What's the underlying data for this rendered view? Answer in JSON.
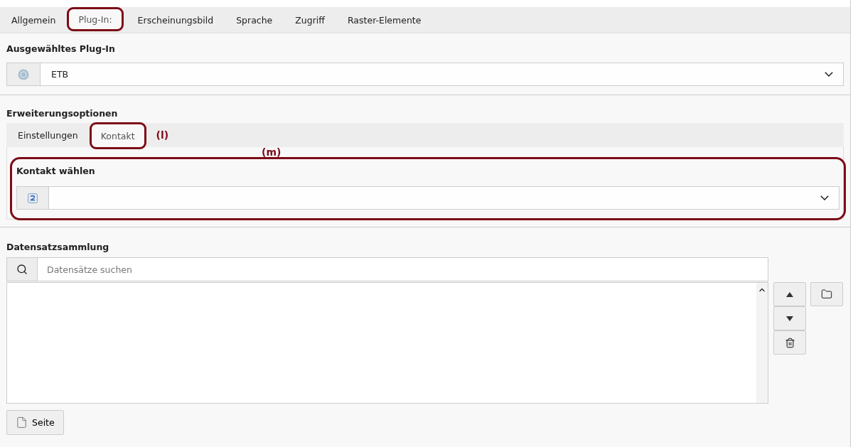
{
  "tabs": [
    {
      "label": "Allgemein",
      "selected": false,
      "highlighted": false
    },
    {
      "label": "Plug-In:",
      "selected": true,
      "highlighted": true
    },
    {
      "label": "Erscheinungsbild",
      "selected": false,
      "highlighted": false
    },
    {
      "label": "Sprache",
      "selected": false,
      "highlighted": false
    },
    {
      "label": "Zugriff",
      "selected": false,
      "highlighted": false
    },
    {
      "label": "Raster-Elemente",
      "selected": false,
      "highlighted": false
    }
  ],
  "plugin": {
    "label": "Ausgewähltes Plug-In",
    "value": "ETB"
  },
  "extension": {
    "label": "Erweiterungsoptionen",
    "tabs": [
      {
        "label": "Einstellungen",
        "selected": false,
        "highlighted": false
      },
      {
        "label": "Kontakt",
        "selected": true,
        "highlighted": true
      }
    ],
    "tab_note": "(l)",
    "section_note": "(m)",
    "section_highlighted": true,
    "contact": {
      "label": "Kontakt wählen"
    }
  },
  "records": {
    "label": "Datensatzsammlung",
    "search": {
      "placeholder": "Datensätze suchen"
    },
    "page_button": "Seite"
  }
}
